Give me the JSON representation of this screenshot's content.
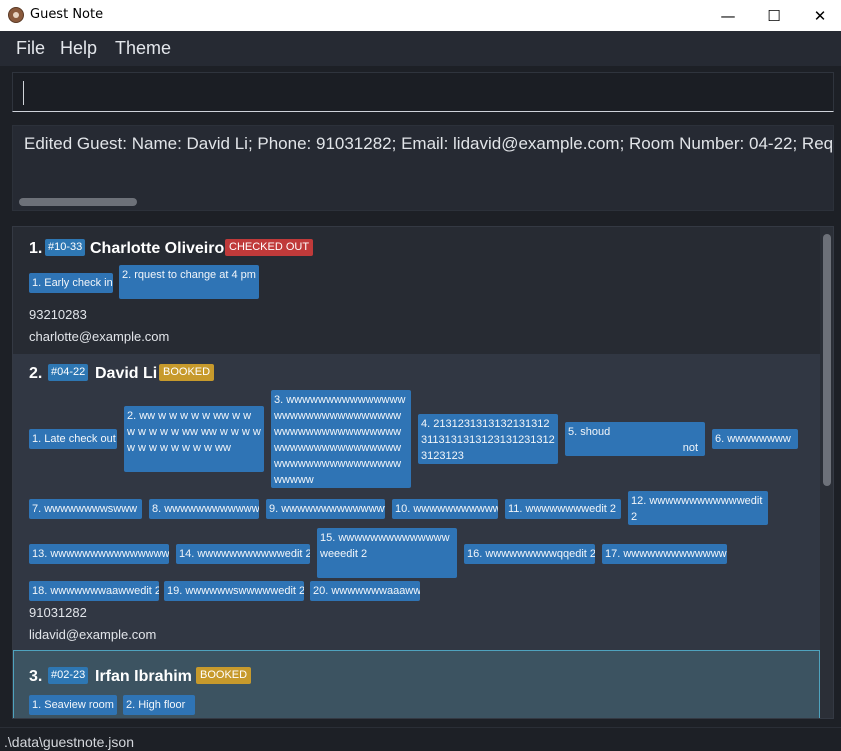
{
  "window": {
    "title": "Guest Note",
    "minimize_glyph": "—",
    "maximize_glyph": "☐",
    "close_glyph": "✕",
    "icon": "app-logo-icon"
  },
  "menu": {
    "file": "File",
    "help": "Help",
    "theme": "Theme"
  },
  "command": {
    "value": ""
  },
  "result": {
    "text": "Edited Guest: Name: David Li; Phone: 91031282; Email: lidavid@example.com; Room Number: 04-22; Request(s): [Late check out]"
  },
  "guests": [
    {
      "index": "1.",
      "room": "#10-33",
      "name": "Charlotte Oliveiro",
      "status": "CHECKED OUT",
      "status_color": "#c03a3a",
      "requests": [
        "1. Early check in",
        "2. rquest to change at 4 pm"
      ],
      "phone": "93210283",
      "email": "charlotte@example.com"
    },
    {
      "index": "2.",
      "room": "#04-22",
      "name": "David Li",
      "status": "BOOKED",
      "status_color": "#c79a2c",
      "requests": [
        "1. Late check out",
        "2. ww  w w w w w ww w w w w w w w ww ww  w w w w w w w w w w w w ww",
        "3. wwwwwwwwwwwwwwwwwwwwwwwwwwwwwwwwwwwwwwwwwwwwwwwwwwwwwwwwwwwwwwwwwwwwwwwwwwwwwwwwwwww",
        "4. 213123131313213131231131313131231312313123123123",
        "5. shoud",
        "not",
        "6. wwwwwwww",
        "7. wwwwwwwwswww",
        "8. wwwwwwwwwwww",
        "9. wwwwwwwwwwwwww",
        "10. wwwwwwwwwww",
        "11. wwwwwwwwedit 2",
        "12. wwwwwwwwwwwwedit 2",
        "13. wwwwwwwwwwwwwwww",
        "14. wwwwwwwwwwwedit 2",
        "15. wwwwwwwwwwwwwwweeedit 2",
        "16. wwwwwwwwwqqedit 2",
        "17. wwwwwwwwwwwwwee",
        "18. wwwwwwwaawwedit 2",
        "19. wwwwwwswwwwwedit 2",
        "20. wwwwwwwaaaww"
      ],
      "phone": "91031282",
      "email": "lidavid@example.com"
    },
    {
      "index": "3.",
      "room": "#02-23",
      "name": "Irfan Ibrahim",
      "status": "BOOKED",
      "status_color": "#c79a2c",
      "requests": [
        "1. Seaview room",
        "2. High floor"
      ]
    }
  ],
  "status_bar": {
    "path": ".\\data\\guestnote.json"
  }
}
